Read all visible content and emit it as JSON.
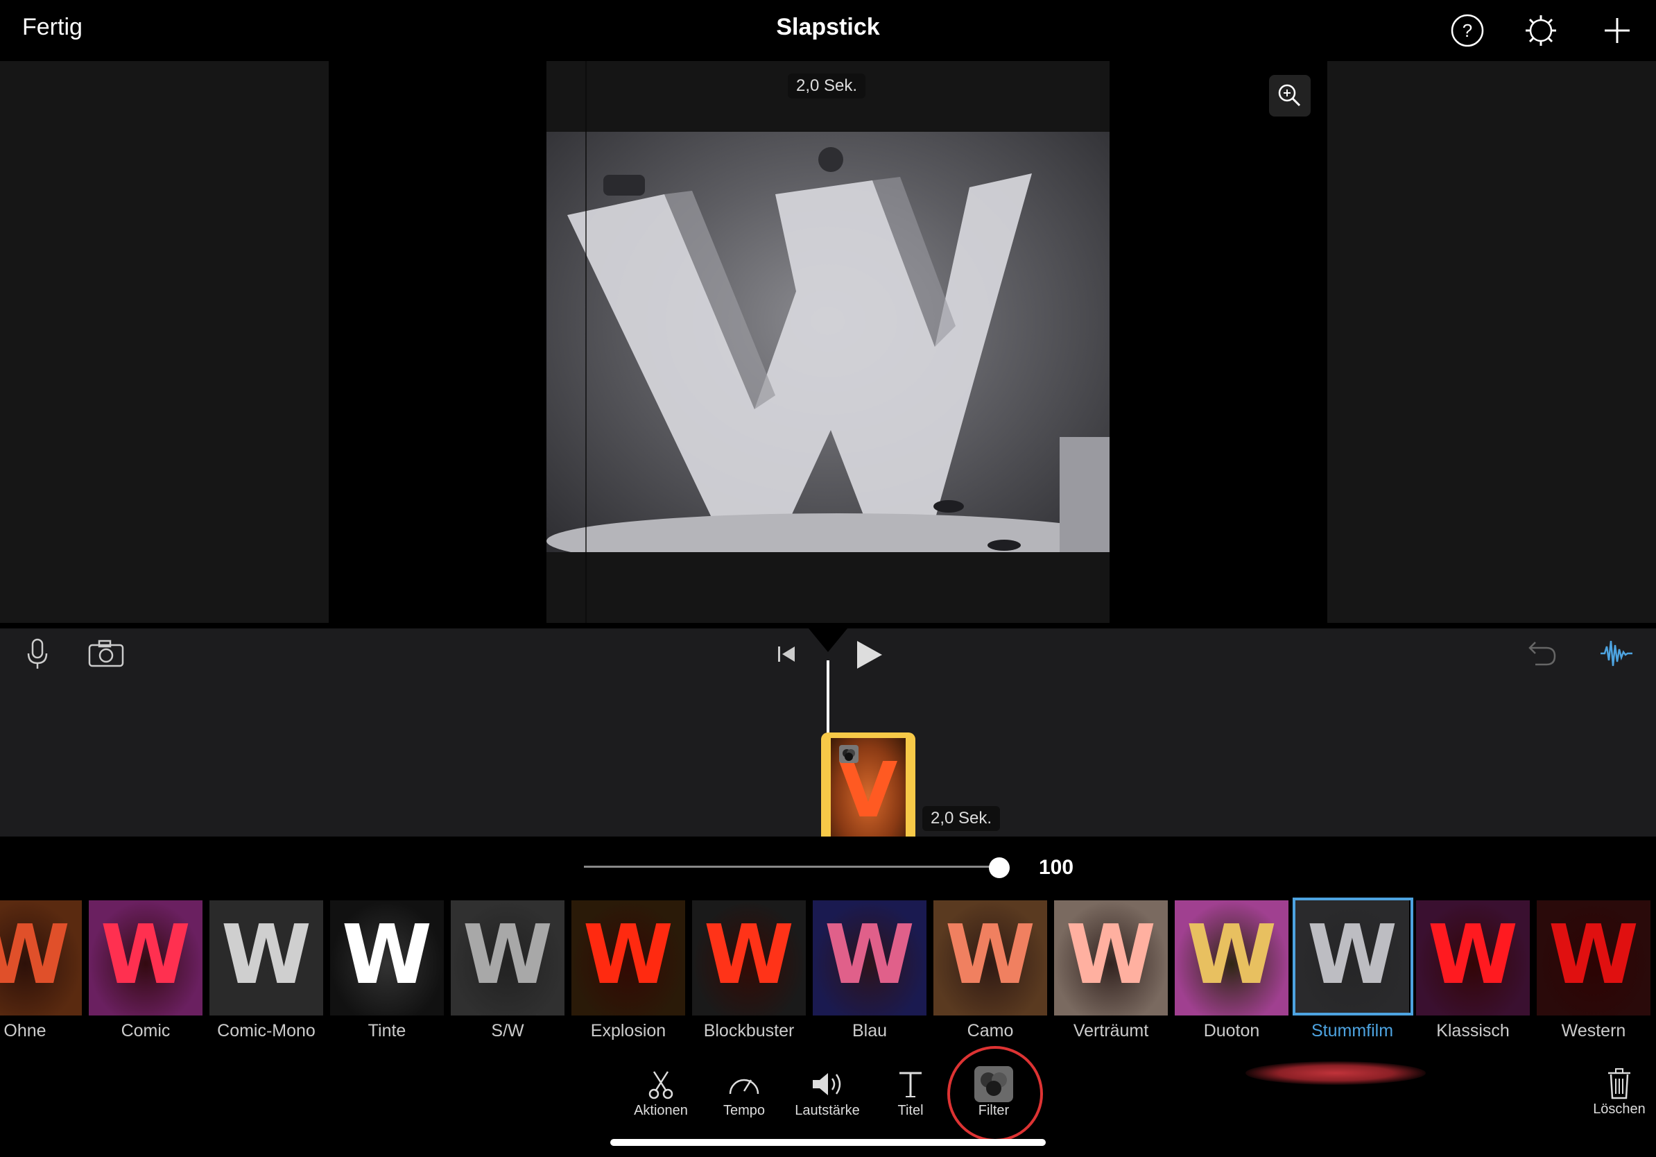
{
  "topbar": {
    "done_label": "Fertig",
    "title": "Slapstick",
    "icons": [
      "help-icon",
      "settings-icon",
      "add-icon"
    ]
  },
  "viewer": {
    "duration_label": "2,0 Sek.",
    "zoom_icon": "zoom-in-icon",
    "preview_letter": "W"
  },
  "timeline": {
    "clip_duration": "2,0 Sek.",
    "clip_letter": "V",
    "controls": [
      "microphone-icon",
      "camera-icon",
      "skip-back-icon",
      "play-icon",
      "undo-icon",
      "audio-waveform-icon"
    ]
  },
  "intensity": {
    "value": "100",
    "fraction": 1.0
  },
  "filters": [
    {
      "label": "Ohne",
      "bg": "#5a2a10",
      "fg": "#e0502a"
    },
    {
      "label": "Comic",
      "bg": "#6a2060",
      "fg": "#ff3050"
    },
    {
      "label": "Comic-Mono",
      "bg": "#2a2a2a",
      "fg": "#cfcfcf"
    },
    {
      "label": "Tinte",
      "bg": "#111111",
      "fg": "#ffffff"
    },
    {
      "label": "S/W",
      "bg": "#303030",
      "fg": "#a8a8a8"
    },
    {
      "label": "Explosion",
      "bg": "#2a1a08",
      "fg": "#ff2a10"
    },
    {
      "label": "Blockbuster",
      "bg": "#1a1a1a",
      "fg": "#ff3318"
    },
    {
      "label": "Blau",
      "bg": "#1a1a50",
      "fg": "#e0608a"
    },
    {
      "label": "Camo",
      "bg": "#5a3a20",
      "fg": "#f08060"
    },
    {
      "label": "Verträumt",
      "bg": "#7a6a60",
      "fg": "#ffb0a0"
    },
    {
      "label": "Duoton",
      "bg": "#a04090",
      "fg": "#e8c060"
    },
    {
      "label": "Stummfilm",
      "bg": "#2a2a2c",
      "fg": "#bdbdc2",
      "selected": true
    },
    {
      "label": "Klassisch",
      "bg": "#3a1030",
      "fg": "#ff1a20"
    },
    {
      "label": "Western",
      "bg": "#2a0a0a",
      "fg": "#e01010"
    }
  ],
  "toolbar": {
    "actions_label": "Aktionen",
    "speed_label": "Tempo",
    "volume_label": "Lautstärke",
    "titles_label": "Titel",
    "filter_label": "Filter",
    "delete_label": "Löschen"
  },
  "colors": {
    "accent_blue": "#4da3e0",
    "clip_yellow": "#f7c948",
    "highlight_red": "#d33"
  }
}
